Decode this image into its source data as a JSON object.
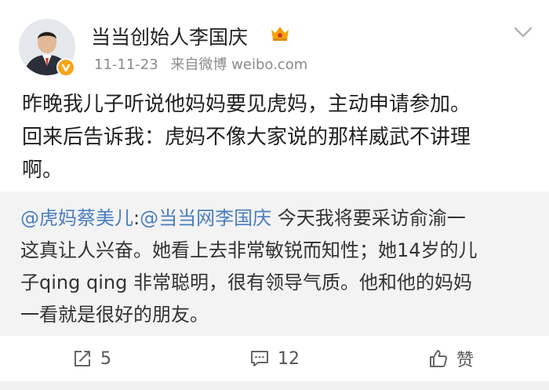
{
  "post": {
    "author": "当当创始人李国庆",
    "time": "11-11-23",
    "source": "来自微博 weibo.com",
    "lines": [
      "昨晚我儿子听说他妈妈要见虎妈，主动申请参加。",
      "回来后告诉我：虎妈不像大家说的那样威武不讲理",
      "啊。"
    ]
  },
  "repost": {
    "mention1": "@虎妈蔡美儿",
    "colon": ":",
    "mention2": "@当当网李国庆",
    "line1_rest": " 今天我将要采访俞渝一",
    "line2": "这真让人兴奋。她看上去非常敏锐而知性；她14岁的儿",
    "line3": "子qing qing 非常聪明，很有领导气质。他和他的妈妈",
    "line4": "一看就是很好的朋友。"
  },
  "actions": {
    "repost_count": "5",
    "comment_count": "12",
    "like_label": "赞"
  },
  "icons": {
    "verified": "verified-badge-icon",
    "crown": "vip-crown-icon",
    "chevron": "chevron-down-icon",
    "repost": "repost-icon",
    "comment": "comment-icon",
    "like": "thumbs-up-icon"
  },
  "colors": {
    "mention": "#4b7dbf",
    "verified": "#f7a51b",
    "repost_bg": "#f3f3f3"
  }
}
